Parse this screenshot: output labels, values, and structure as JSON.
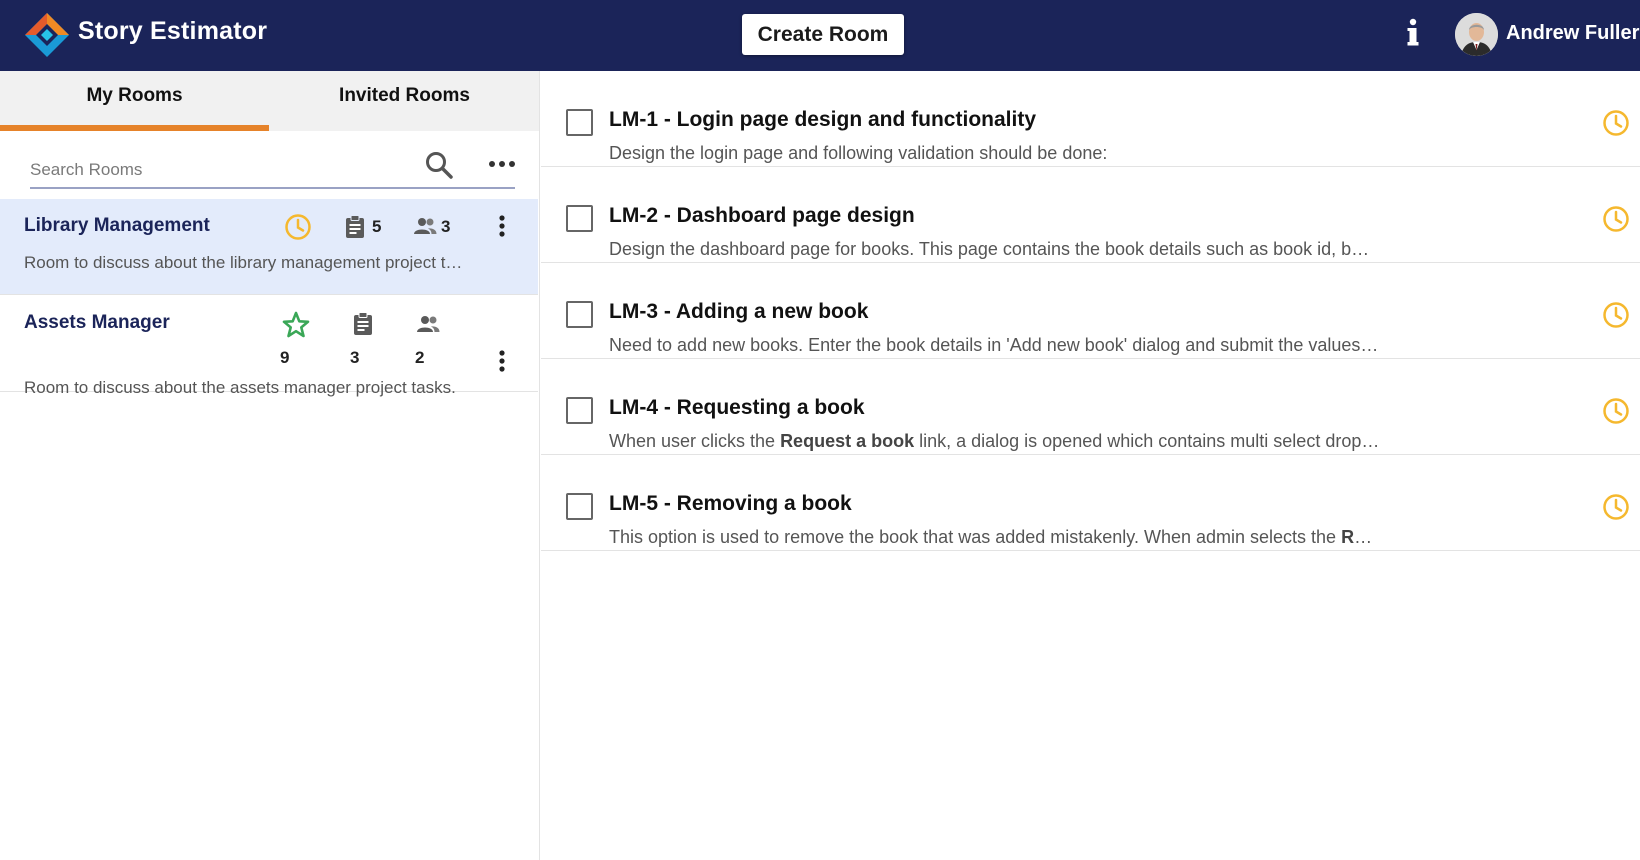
{
  "header": {
    "app_title": "Story Estimator",
    "create_room_label": "Create Room",
    "user_name": "Andrew Fuller",
    "background_color": "#1b2459"
  },
  "sidebar": {
    "tabs": [
      {
        "label": "My Rooms",
        "active": true
      },
      {
        "label": "Invited Rooms",
        "active": false
      }
    ],
    "search_placeholder": "Search Rooms",
    "rooms": [
      {
        "title": "Library Management",
        "status_icon": "clock-icon",
        "stories_count": "5",
        "participants_count": "3",
        "description": "Room to discuss about the library management project t…",
        "selected": true
      },
      {
        "title": "Assets Manager",
        "status_icon": "star-icon",
        "points_count": "9",
        "stories_count": "3",
        "participants_count": "2",
        "description": "Room to discuss about the assets manager project tasks.",
        "selected": false
      }
    ]
  },
  "tasks": [
    {
      "title": "LM-1 - Login page design and functionality",
      "description": "Design the login page and following validation should be done:"
    },
    {
      "title": "LM-2 - Dashboard page design",
      "description": "Design the dashboard page for books. This page contains the book details such as book id, b…"
    },
    {
      "title": "LM-3 - Adding a new book",
      "description": "Need to add new books. Enter the book details in 'Add new book' dialog and submit the values…"
    },
    {
      "title": "LM-4 - Requesting a book",
      "description_prefix": "When user clicks the ",
      "description_bold": "Request a book",
      "description_suffix": " link, a dialog is opened which contains multi select drop…"
    },
    {
      "title": "LM-5 - Removing a book",
      "description_prefix": "This option is used to remove the book that was added mistakenly. When admin selects the ",
      "description_bold": "R",
      "description_suffix": "…"
    }
  ],
  "colors": {
    "accent_orange": "#e6832a",
    "clock_yellow": "#f5b82e",
    "star_green": "#3aa757",
    "selected_row": "#e3ebfb"
  }
}
